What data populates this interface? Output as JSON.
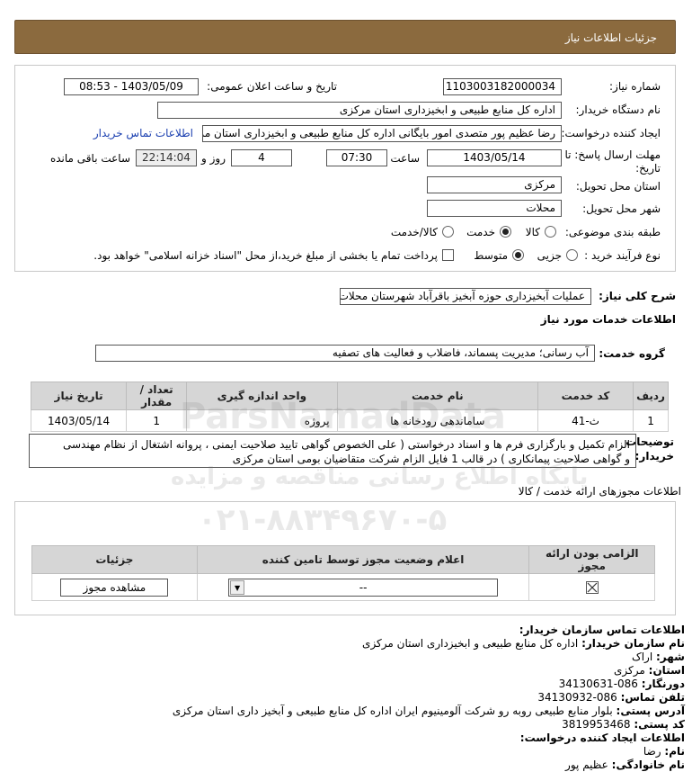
{
  "header": {
    "title": "جزئیات اطلاعات نیاز"
  },
  "form": {
    "need_number_label": "شماره نیاز:",
    "need_number": "1103003182000034",
    "announce_label": "تاریخ و ساعت اعلان عمومی:",
    "announce_value": "1403/05/09 - 08:53",
    "buyer_label": "نام دستگاه خریدار:",
    "buyer_value": "اداره کل منابع طبیعی و ابخیزداری استان مرکزی",
    "creator_label": "ایجاد کننده درخواست:",
    "creator_value": "رضا عظیم پور متصدی امور بایگانی اداره کل منابع طبیعی و ابخیزداری استان مرکزی",
    "contact_link": "اطلاعات تماس خریدار",
    "deadline_label_1": "مهلت ارسال پاسخ: تا",
    "deadline_label_2": "تاریخ:",
    "deadline_date": "1403/05/14",
    "time_label": "ساعت",
    "deadline_time": "07:30",
    "days_value": "4",
    "days_label": "روز و",
    "remain_time": "22:14:04",
    "remain_label": "ساعت باقی مانده",
    "province_label": "استان محل تحویل:",
    "province_value": "مرکزی",
    "city_label": "شهر محل تحویل:",
    "city_value": "محلات",
    "category_label": "طبقه بندی موضوعی:",
    "cat_goods": "کالا",
    "cat_service": "خدمت",
    "cat_both": "کالا/خدمت",
    "process_label": "نوع فرآیند خرید :",
    "proc_partial": "جزیی",
    "proc_medium": "متوسط",
    "payment_note": "پرداخت تمام یا بخشی از مبلغ خرید،از محل \"اسناد خزانه اسلامی\" خواهد بود."
  },
  "summary": {
    "label": "شرح کلی نیاز:",
    "value": "عملیات آبخیزداری حوزه آبخیز باقرآباد شهرستان محلات"
  },
  "services": {
    "title": "اطلاعات خدمات مورد نیاز",
    "group_label": "گروه خدمت:",
    "group_value": "آب رسانی؛ مدیریت پسماند، فاضلاب و فعالیت های تصفیه",
    "headers": [
      "ردیف",
      "کد خدمت",
      "نام خدمت",
      "واحد اندازه گیری",
      "تعداد / مقدار",
      "تاریخ نیاز"
    ],
    "rows": [
      [
        "1",
        "ث-41",
        "ساماندهی رودخانه ها",
        "پروژه",
        "1",
        "1403/05/14"
      ]
    ]
  },
  "buyer_notes": {
    "label_1": "توضیحات",
    "label_2": "خریدار:",
    "line_1": "الزام تکمیل و بارگزاری فرم ها و اسناد درخواستی ( علی الخصوص گواهی تایید صلاحیت ایمنی ، پروانه اشتغال از نظام مهندسی",
    "line_2": "و گواهی صلاحیت پیمانکاری ) در قالب 1 فایل الزام شرکت متقاضیان بومی استان مرکزی"
  },
  "permits": {
    "title": "اطلاعات مجوزهای ارائه خدمت / کالا",
    "headers": [
      "الزامی بودن ارائه مجوز",
      "اعلام وضعیت مجوز توسط تامین کننده",
      "جزئیات"
    ],
    "select_value": "--",
    "view_button": "مشاهده مجوز"
  },
  "contact": {
    "title": "اطلاعات تماس سازمان خریدار:",
    "org_label": "نام سازمان خریدار:",
    "org_value": "اداره کل منابع طبیعی و ابخیزداری استان مرکزی",
    "city_label": "شهر:",
    "city_value": "اراک",
    "province_label": "استان:",
    "province_value": "مرکزی",
    "fax_label": "دورنگار:",
    "fax_value": "086-34130631",
    "phone_label": "تلفن تماس:",
    "phone_value": "086-34130932",
    "address_label": "آدرس پستی:",
    "address_value": "بلوار منابع طبیعی روبه رو شرکت آلومینیوم ایران اداره کل منابع طبیعی و آبخیز داری استان مرکزی",
    "postal_label": "کد پستی:",
    "postal_value": "3819953468",
    "creator_title": "اطلاعات ایجاد کننده درخواست:",
    "name_label": "نام:",
    "name_value": "رضا",
    "family_label": "نام خانوادگی:",
    "family_value": "عظیم پور"
  },
  "watermark": {
    "site": "ParsNamadData",
    "tagline": "پایگاه اطلاع رسانی مناقصه و مزایده",
    "phone": "۰۲۱-۸۸۳۴۹۶۷۰-۵"
  }
}
